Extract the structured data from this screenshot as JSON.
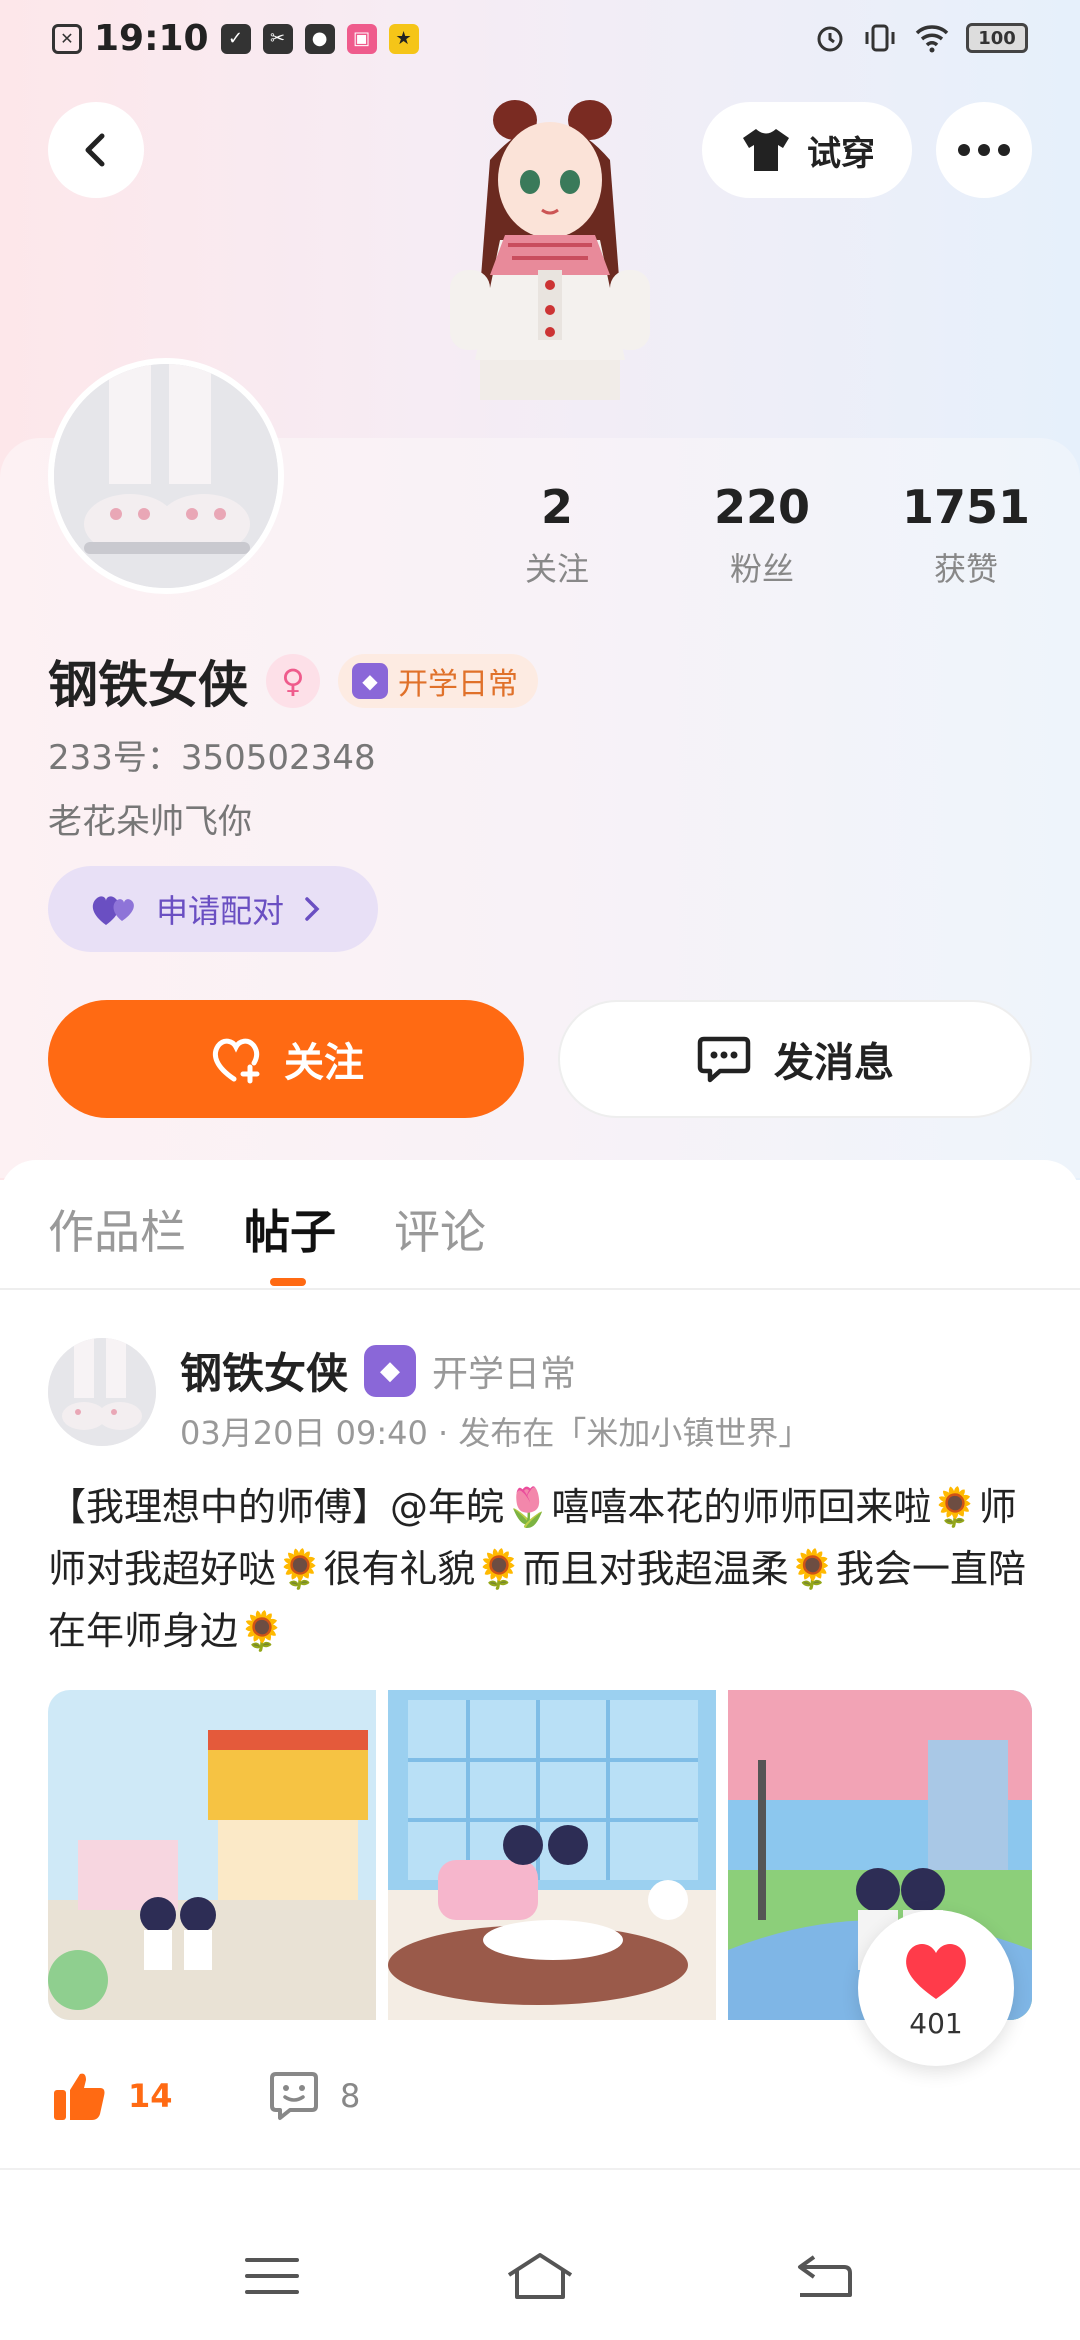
{
  "status_bar": {
    "time": "19:10",
    "battery": "100"
  },
  "header": {
    "try_on_label": "试穿"
  },
  "profile": {
    "name": "钢铁女侠",
    "tag": "开学日常",
    "uid": "233号：350502348",
    "bio": "老花朵帅飞你",
    "pair_label": "申请配对",
    "stats": [
      {
        "value": "2",
        "label": "关注"
      },
      {
        "value": "220",
        "label": "粉丝"
      },
      {
        "value": "1751",
        "label": "获赞"
      }
    ],
    "follow_label": "关注",
    "message_label": "发消息"
  },
  "tabs": [
    "作品栏",
    "帖子",
    "评论"
  ],
  "active_tab": "帖子",
  "post": {
    "author": "钢铁女侠",
    "tag": "开学日常",
    "meta": "03月20日 09:40 · 发布在「米加小镇世界」",
    "text": "【我理想中的师傅】@年皖🌷嘻嘻本花的师师回来啦🌻师师对我超好哒🌻很有礼貌🌻而且对我超温柔🌻我会一直陪在年师身边🌻",
    "likes": "14",
    "comments": "8",
    "float_likes": "401"
  },
  "colors": {
    "accent": "#ff6a13",
    "purple": "#6a4fc2"
  }
}
